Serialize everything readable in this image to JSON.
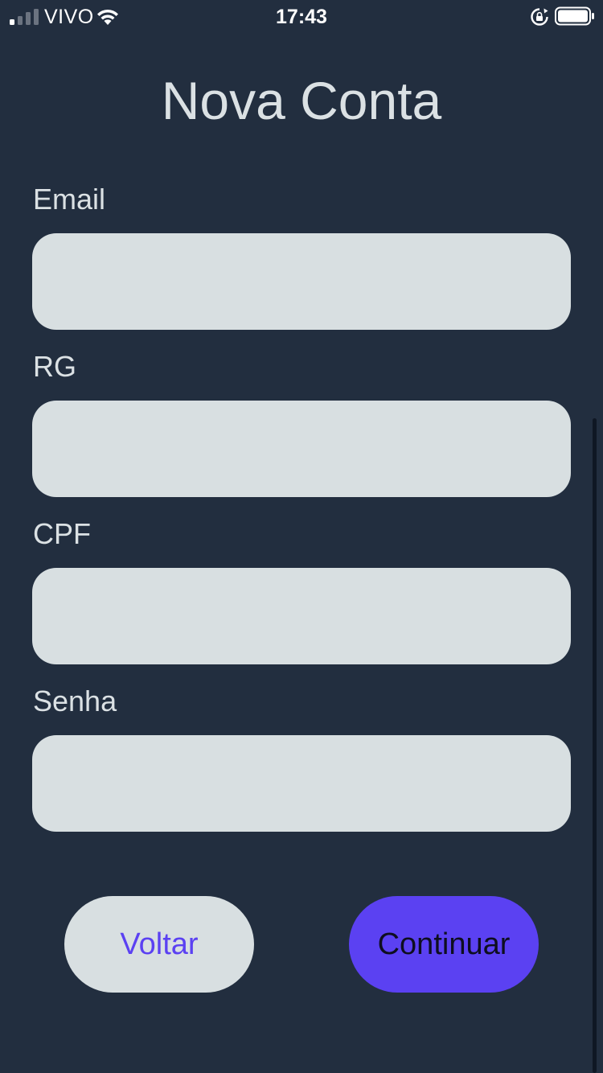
{
  "status_bar": {
    "carrier": "VIVO",
    "time": "17:43",
    "signal_icon": "cellular-signal-icon",
    "wifi_icon": "wifi-icon",
    "rotation_lock_icon": "rotation-lock-icon",
    "battery_icon": "battery-icon"
  },
  "page": {
    "title": "Nova Conta"
  },
  "form": {
    "email_label": "Email",
    "email_value": "",
    "rg_label": "RG",
    "rg_value": "",
    "cpf_label": "CPF",
    "cpf_value": "",
    "senha_label": "Senha",
    "senha_value": ""
  },
  "actions": {
    "back_label": "Voltar",
    "continue_label": "Continuar"
  },
  "colors": {
    "background": "#222e3f",
    "text_light": "#dbe1e4",
    "input_bg": "#d8dfe1",
    "accent": "#5b41f2"
  }
}
